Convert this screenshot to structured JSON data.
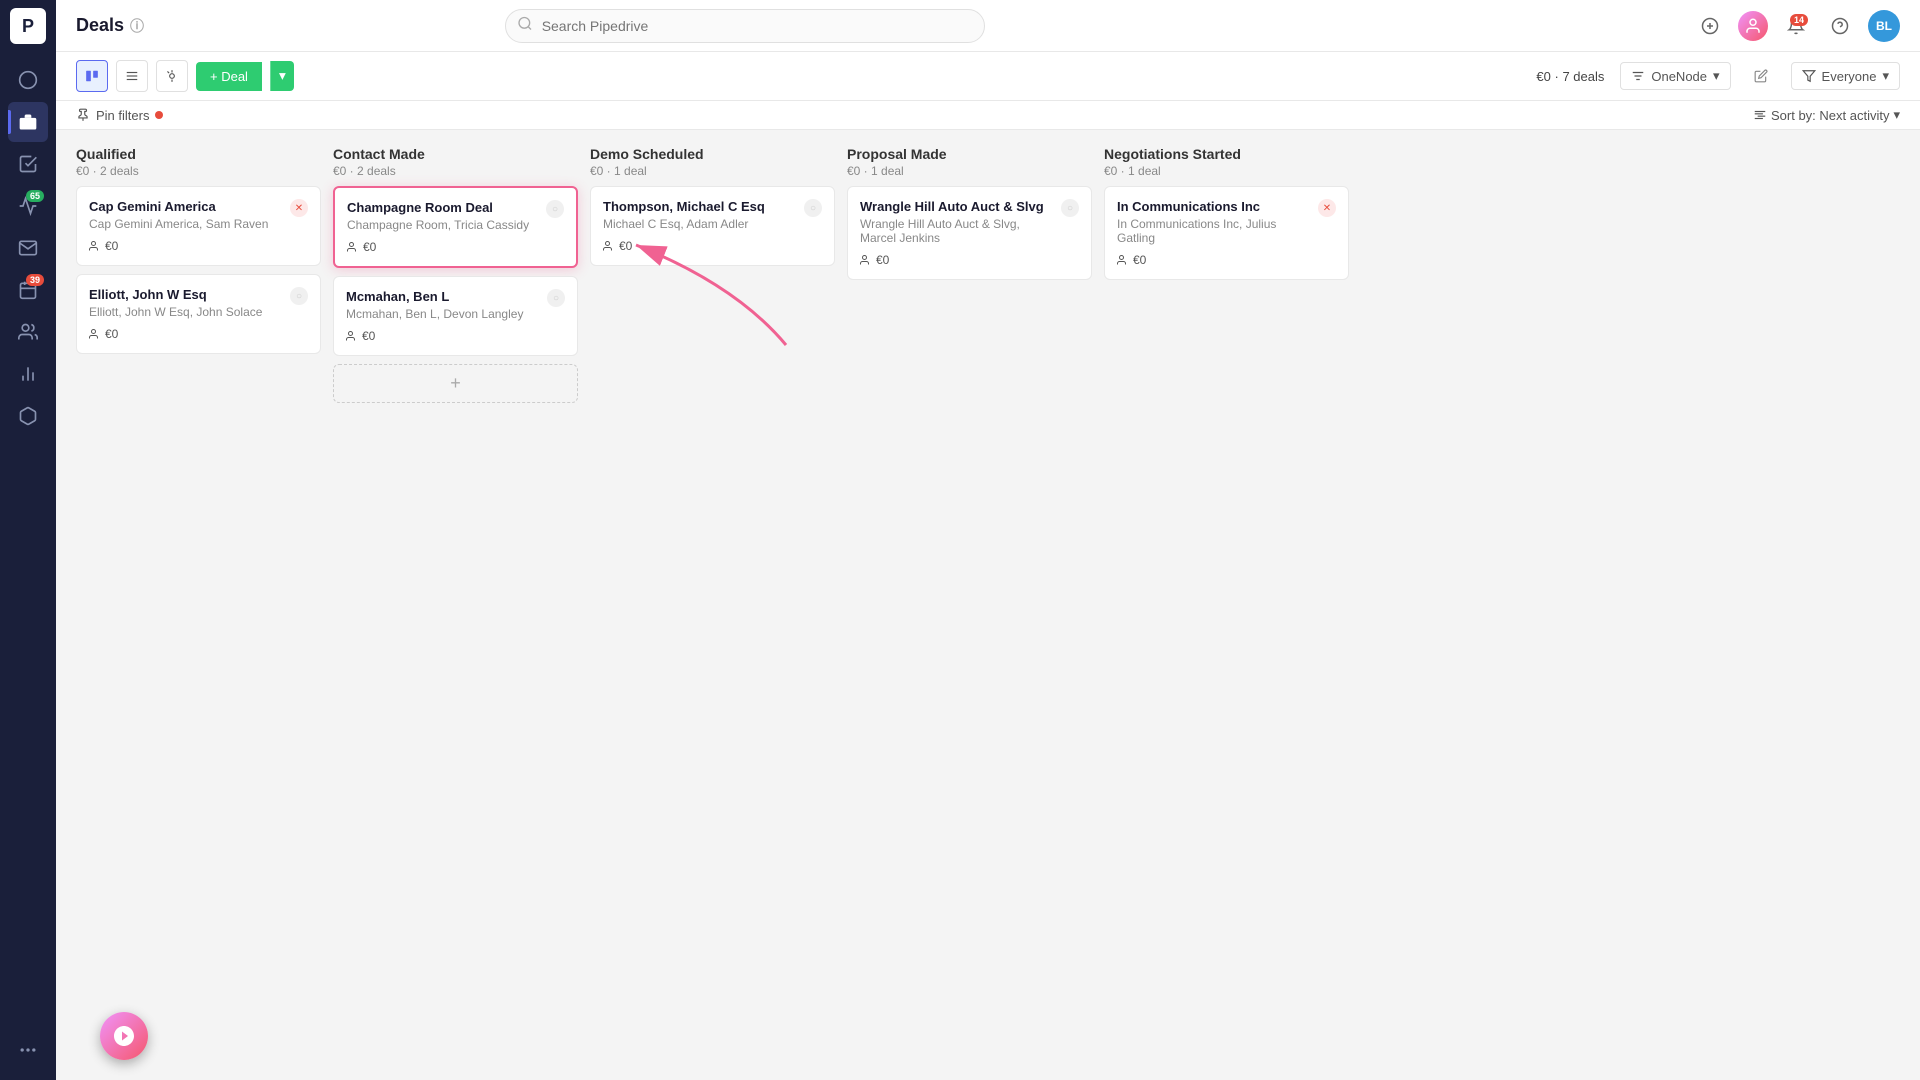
{
  "app": {
    "title": "Deals",
    "search_placeholder": "Search Pipedrive"
  },
  "sidebar": {
    "logo": "P",
    "items": [
      {
        "id": "activity",
        "icon": "circle",
        "label": "Activity",
        "active": false
      },
      {
        "id": "deals",
        "icon": "tag",
        "label": "Deals",
        "active": true
      },
      {
        "id": "tasks",
        "icon": "check",
        "label": "Tasks",
        "active": false
      },
      {
        "id": "campaigns",
        "icon": "megaphone",
        "label": "Campaigns",
        "active": false,
        "badge": "65",
        "badge_type": "green"
      },
      {
        "id": "email",
        "icon": "mail",
        "label": "Email",
        "active": false
      },
      {
        "id": "calendar",
        "icon": "calendar",
        "label": "Calendar",
        "active": false
      },
      {
        "id": "contacts",
        "icon": "contacts",
        "label": "Contacts",
        "active": false
      },
      {
        "id": "reports",
        "icon": "chart",
        "label": "Reports",
        "active": false
      },
      {
        "id": "products",
        "icon": "box",
        "label": "Products",
        "active": false
      },
      {
        "id": "more",
        "icon": "more",
        "label": "More",
        "active": false
      }
    ]
  },
  "topbar": {
    "notifications_badge": "14",
    "user_initials": "BL"
  },
  "toolbar": {
    "add_deal_label": "+ Deal",
    "total": "€0",
    "deals_count": "7 deals",
    "pipeline_name": "OneNode",
    "filter_label": "Everyone",
    "edit_tooltip": "Edit pipeline"
  },
  "filters_bar": {
    "pin_label": "Pin filters",
    "sort_label": "Sort by: Next activity"
  },
  "columns": [
    {
      "id": "qualified",
      "title": "Qualified",
      "total": "€0",
      "count": "2 deals",
      "deals": [
        {
          "id": "cap-gemini",
          "title": "Cap Gemini America",
          "subtitle": "Cap Gemini America, Sam Raven",
          "amount": "€0",
          "status": "red",
          "highlighted": false
        },
        {
          "id": "elliott",
          "title": "Elliott, John W Esq",
          "subtitle": "Elliott, John W Esq, John Solace",
          "amount": "€0",
          "status": "gray",
          "highlighted": false
        }
      ]
    },
    {
      "id": "contact-made",
      "title": "Contact Made",
      "total": "€0",
      "count": "2 deals",
      "deals": [
        {
          "id": "champagne",
          "title": "Champagne Room Deal",
          "subtitle": "Champagne Room, Tricia Cassidy",
          "amount": "€0",
          "status": "gray",
          "highlighted": true
        },
        {
          "id": "mcmahan",
          "title": "Mcmahan, Ben L",
          "subtitle": "Mcmahan, Ben L, Devon Langley",
          "amount": "€0",
          "status": "gray",
          "highlighted": false
        }
      ]
    },
    {
      "id": "demo-scheduled",
      "title": "Demo Scheduled",
      "total": "€0",
      "count": "1 deal",
      "deals": [
        {
          "id": "thompson",
          "title": "Thompson, Michael C Esq",
          "subtitle": "Michael C Esq, Adam Adler",
          "amount": "€0",
          "status": "gray",
          "highlighted": false
        }
      ]
    },
    {
      "id": "proposal-made",
      "title": "Proposal Made",
      "total": "€0",
      "count": "1 deal",
      "deals": [
        {
          "id": "wrangle",
          "title": "Wrangle Hill Auto Auct & Slvg",
          "subtitle": "Wrangle Hill Auto Auct & Slvg, Marcel Jenkins",
          "amount": "€0",
          "status": "gray",
          "highlighted": false
        }
      ]
    },
    {
      "id": "negotiations-started",
      "title": "Negotiations Started",
      "total": "€0",
      "count": "1 deal",
      "deals": [
        {
          "id": "in-communications",
          "title": "In Communications Inc",
          "subtitle": "In Communications Inc, Julius Gatling",
          "amount": "€0",
          "status": "red",
          "highlighted": false
        }
      ]
    }
  ]
}
